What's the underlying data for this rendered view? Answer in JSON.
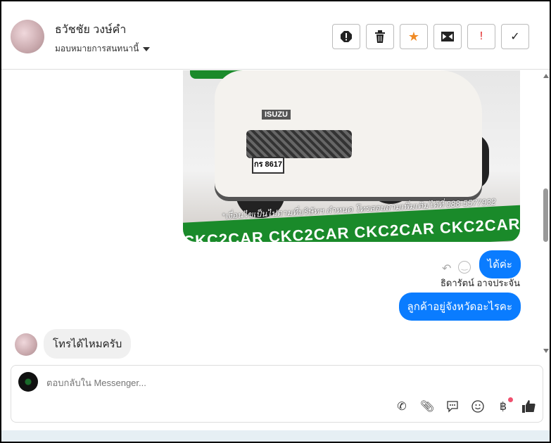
{
  "header": {
    "contact_name": "ธวัชชัย วงษ์คำ",
    "assign_label": "มอบหมายการสนทนานี้",
    "actions": [
      "report",
      "delete",
      "star",
      "mark-unread",
      "important",
      "done"
    ]
  },
  "photo": {
    "plate": "กร 8617",
    "brand": "ISUZU",
    "caption": "*เงื่อนไขเป็นไปตามที่บริษัทฯ กำหนด โทรสอบถามเพิ่มเติมได้ที่ 088-5577932",
    "banner": "CKC2CAR CKC2CAR CKC2CAR CKC2CAR CKC2"
  },
  "messages": [
    {
      "text": "ได้ค่ะ",
      "direction": "out"
    },
    {
      "sender": "ธิดารัตน์ อาจประจัน"
    },
    {
      "text": "ลูกค้าอยู่จังหวัดอะไรคะ",
      "direction": "out"
    },
    {
      "text": "โทรได้ไหมครับ",
      "direction": "in"
    }
  ],
  "composer": {
    "placeholder": "ตอบกลับใน Messenger..."
  },
  "colors": {
    "accent": "#0a7cff",
    "star": "#f08a24",
    "important": "#e02020"
  }
}
